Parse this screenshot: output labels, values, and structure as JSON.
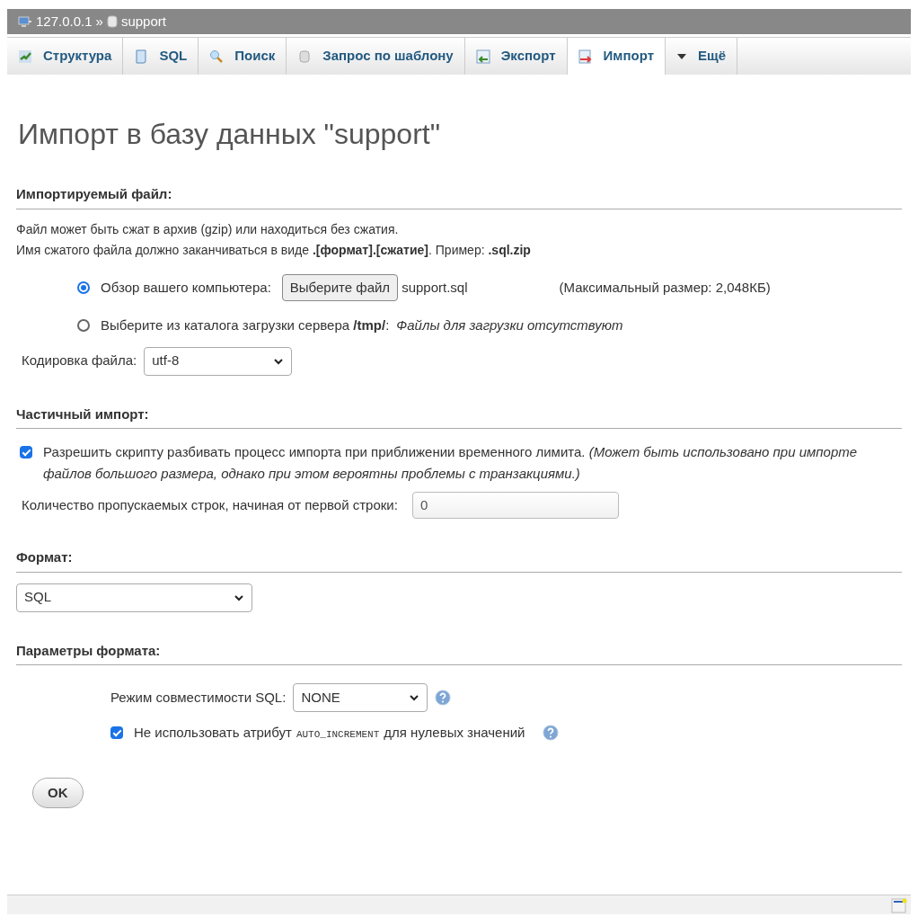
{
  "breadcrumb": {
    "items": [
      {
        "label": "127.0.0.1",
        "kind": "server"
      },
      {
        "label": "support",
        "kind": "database"
      }
    ],
    "separator": "»"
  },
  "tabs": [
    {
      "label": "Структура",
      "kind": "structure",
      "selected": false
    },
    {
      "label": "SQL",
      "kind": "sql",
      "selected": false
    },
    {
      "label": "Поиск",
      "kind": "search",
      "selected": false
    },
    {
      "label": "Запрос по шаблону",
      "kind": "query",
      "selected": false
    },
    {
      "label": "Экспорт",
      "kind": "export",
      "selected": false
    },
    {
      "label": "Импорт",
      "kind": "import",
      "selected": true
    },
    {
      "label": "Ещё",
      "kind": "more",
      "selected": false
    }
  ],
  "title": "Импорт в базу данных \"support\"",
  "file_section": {
    "heading": "Импортируемый файл:",
    "notes": [
      "Файл может быть сжат в архив (gzip) или находиться без сжатия.",
      "Имя сжатого файла должно заканчиваться в виде **.[формат].[сжатие]**. Пример: **.sql.zip**"
    ],
    "browse": {
      "selected": true,
      "label": "Обзор вашего компьютера:",
      "button": "Выберите файл",
      "file_name": "support.sql",
      "max_size": "(Максимальный размер: 2,048КБ)"
    },
    "server": {
      "selected": false,
      "label": "Выберите из каталога загрузки сервера **/tmp/**:",
      "note": "Файлы для загрузки отсутствуют"
    },
    "charset": {
      "label": "Кодировка файла:",
      "value": "utf-8"
    }
  },
  "partial_section": {
    "heading": "Частичный импорт:",
    "allow_interrupt": {
      "checked": true,
      "label": "Разрешить скрипту разбивать процесс импорта при приближении временного лимита. *(Может быть использовано при импорте файлов большого размера, однако при этом вероятны проблемы с транзакциями.)*"
    },
    "skip_rows": {
      "label": "Количество пропускаемых строк, начиная от первой строки:",
      "value": "0"
    }
  },
  "format_section": {
    "heading": "Формат:",
    "value": "SQL"
  },
  "options_section": {
    "heading": "Параметры формата:",
    "compat": {
      "label": "Режим совместимости SQL:",
      "value": "NONE"
    },
    "no_auto_increment": {
      "checked": true,
      "label_before": "Не использовать атрибут",
      "code": "AUTO_INCREMENT",
      "label_after": "для нулевых значений"
    }
  },
  "ok_button": "OK"
}
